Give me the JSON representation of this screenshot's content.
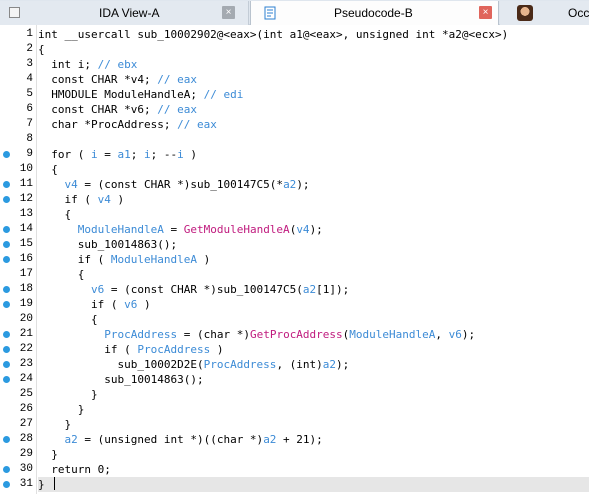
{
  "tabs": [
    {
      "label": "IDA View-A",
      "close_label": "×"
    },
    {
      "label": "Pseudocode-B",
      "close_label": "×"
    },
    {
      "label": "Occ"
    }
  ],
  "lines": [
    {
      "no": "1",
      "bp": false,
      "text": "int __usercall sub_10002902@<eax>(int a1@<eax>, unsigned int *a2@<ecx>)"
    },
    {
      "no": "2",
      "bp": false,
      "text": "{"
    },
    {
      "no": "3",
      "bp": false,
      "text": "  int i; // ebx"
    },
    {
      "no": "4",
      "bp": false,
      "text": "  const CHAR *v4; // eax"
    },
    {
      "no": "5",
      "bp": false,
      "text": "  HMODULE ModuleHandleA; // edi"
    },
    {
      "no": "6",
      "bp": false,
      "text": "  const CHAR *v6; // eax"
    },
    {
      "no": "7",
      "bp": false,
      "text": "  char *ProcAddress; // eax"
    },
    {
      "no": "8",
      "bp": false,
      "text": ""
    },
    {
      "no": "9",
      "bp": true,
      "text": "  for ( i = a1; i; --i )"
    },
    {
      "no": "10",
      "bp": false,
      "text": "  {"
    },
    {
      "no": "11",
      "bp": true,
      "text": "    v4 = (const CHAR *)sub_100147C5(*a2);"
    },
    {
      "no": "12",
      "bp": true,
      "text": "    if ( v4 )"
    },
    {
      "no": "13",
      "bp": false,
      "text": "    {"
    },
    {
      "no": "14",
      "bp": true,
      "text": "      ModuleHandleA = GetModuleHandleA(v4);"
    },
    {
      "no": "15",
      "bp": true,
      "text": "      sub_10014863();"
    },
    {
      "no": "16",
      "bp": true,
      "text": "      if ( ModuleHandleA )"
    },
    {
      "no": "17",
      "bp": false,
      "text": "      {"
    },
    {
      "no": "18",
      "bp": true,
      "text": "        v6 = (const CHAR *)sub_100147C5(a2[1]);"
    },
    {
      "no": "19",
      "bp": true,
      "text": "        if ( v6 )"
    },
    {
      "no": "20",
      "bp": false,
      "text": "        {"
    },
    {
      "no": "21",
      "bp": true,
      "text": "          ProcAddress = (char *)GetProcAddress(ModuleHandleA, v6);"
    },
    {
      "no": "22",
      "bp": true,
      "text": "          if ( ProcAddress )"
    },
    {
      "no": "23",
      "bp": true,
      "text": "            sub_10002D2E(ProcAddress, (int)a2);"
    },
    {
      "no": "24",
      "bp": true,
      "text": "          sub_10014863();"
    },
    {
      "no": "25",
      "bp": false,
      "text": "        }"
    },
    {
      "no": "26",
      "bp": false,
      "text": "      }"
    },
    {
      "no": "27",
      "bp": false,
      "text": "    }"
    },
    {
      "no": "28",
      "bp": true,
      "text": "    a2 = (unsigned int *)((char *)a2 + 21);"
    },
    {
      "no": "29",
      "bp": false,
      "text": "  }"
    },
    {
      "no": "30",
      "bp": true,
      "text": "  return 0;"
    },
    {
      "no": "31",
      "bp": true,
      "text": "}"
    }
  ],
  "current_line": "31",
  "colors": {
    "variable": "#3c8bd6",
    "function": "#c01b7e",
    "breakpoint": "#2b9ae0",
    "current_line_bg": "#e6e6e6"
  }
}
